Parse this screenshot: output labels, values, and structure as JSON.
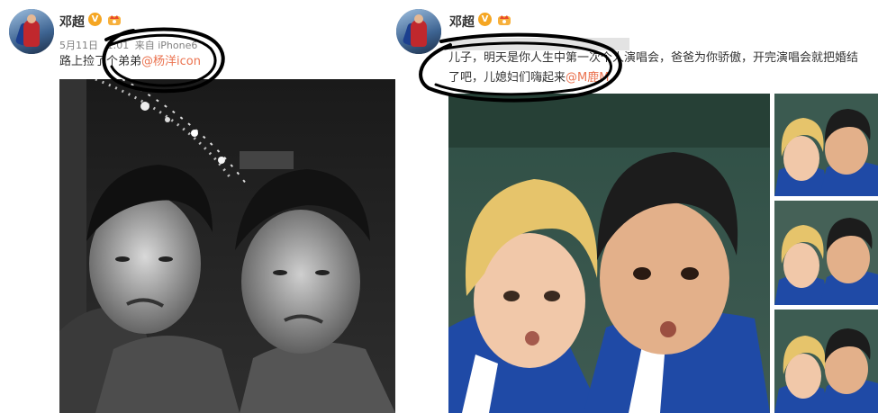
{
  "left_post": {
    "username": "邓超",
    "timestamp": "5月11日",
    "time_partial": "1:01",
    "source_prefix": "来自",
    "source_device": "iPhone",
    "source_tail": "6",
    "text": "路上捡了个弟弟",
    "mention": "@杨洋icon"
  },
  "right_post": {
    "username": "邓超",
    "text_line1": "儿子，明天是你人生中第一次个人演唱会，爸爸为你骄傲，开完演唱会就把婚结",
    "text_line2": "了吧，儿媳妇们嗨起来",
    "mention": "@M鹿M"
  },
  "colors": {
    "mention": "#eb7350",
    "username": "#333333",
    "meta": "#808080",
    "verified": "#f5a623",
    "scribble": "#000000"
  },
  "icons": {
    "verified": "verified-v-icon",
    "crown": "vip-crown-icon"
  }
}
